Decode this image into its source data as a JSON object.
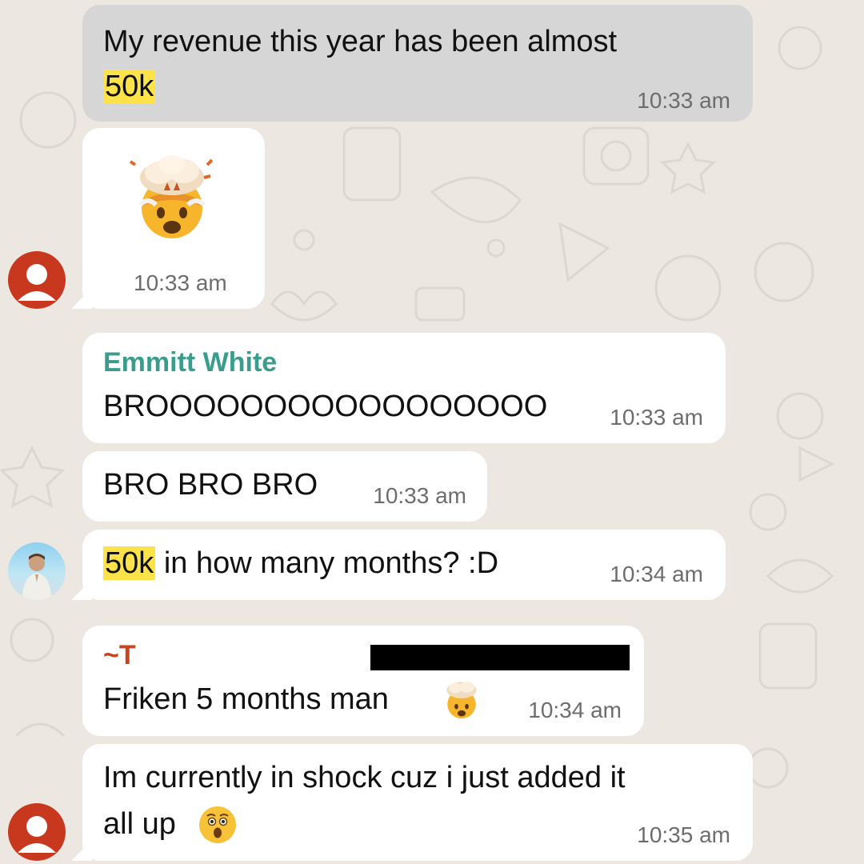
{
  "messages": [
    {
      "text_before": "My revenue this year has been almost",
      "highlight": "50k",
      "time": "10:33 am"
    },
    {
      "emoji": "exploding-head",
      "time": "10:33 am"
    },
    {
      "sender": "Emmitt White",
      "text": "BROOOOOOOOOOOOOOOOO",
      "time": "10:33 am"
    },
    {
      "text": "BRO BRO BRO",
      "time": "10:33 am"
    },
    {
      "highlight": "50k",
      "text_after": " in how many months? :D",
      "time": "10:34 am"
    },
    {
      "sender": "~T",
      "text": "Friken 5 months man",
      "emoji": "exploding-head",
      "time": "10:34 am"
    },
    {
      "text_line1": "Im currently in shock cuz i just added it",
      "text_line2": "all up",
      "emoji": "astonished-face",
      "time": "10:35 am"
    }
  ],
  "colors": {
    "chat_background": "#ece8e1",
    "sender_emmitt": "#3a9c8c",
    "sender_t": "#c8431e",
    "highlight": "#fde24a",
    "outgoing_bubble": "#d7d6d7",
    "avatar_default": "#c8381e"
  }
}
